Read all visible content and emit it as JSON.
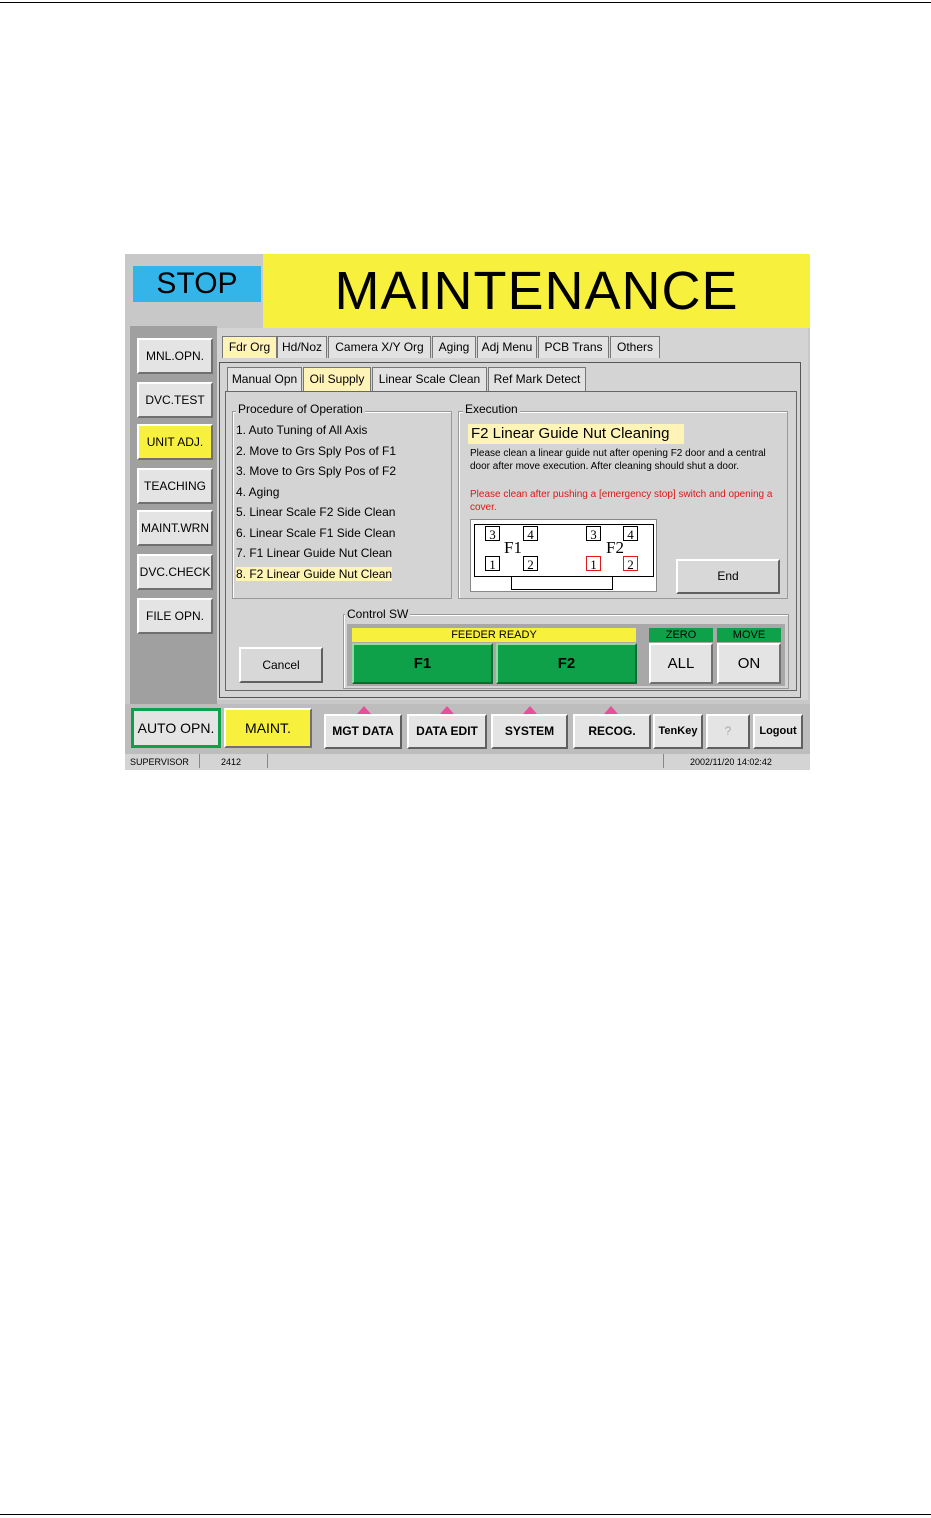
{
  "header": {
    "stop_label": "STOP",
    "title": "MAINTENANCE"
  },
  "sidebar": {
    "buttons": [
      {
        "label": "MNL.OPN."
      },
      {
        "label": "DVC.TEST"
      },
      {
        "label": "UNIT ADJ."
      },
      {
        "label": "TEACHING"
      },
      {
        "label": "MAINT.WRN"
      },
      {
        "label": "DVC.CHECK"
      },
      {
        "label": "FILE OPN."
      }
    ],
    "active_index": 2
  },
  "tabs": [
    "Fdr Org",
    "Hd/Noz",
    "Camera X/Y Org",
    "Aging",
    "Adj Menu",
    "PCB Trans",
    "Others"
  ],
  "subtabs": [
    "Manual Opn",
    "Oil Supply",
    "Linear Scale Clean",
    "Ref Mark Detect"
  ],
  "procedure": {
    "label": "Procedure of Operation",
    "steps": [
      "1. Auto Tuning of All Axis",
      "2. Move to Grs Sply Pos of F1",
      "3. Move to Grs Sply Pos of F2",
      "4. Aging",
      "5. Linear Scale F2 Side Clean",
      "6. Linear Scale F1 Side Clean",
      "7. F1 Linear Guide Nut Clean",
      "8. F2 Linear Guide Nut Clean"
    ],
    "active_step": 7
  },
  "execution": {
    "label": "Execution",
    "title": "F2 Linear Guide Nut Cleaning",
    "description": "Please clean a linear guide nut after opening F2 door and a central door after move execution. After cleaning should shut a door.",
    "warning": "Please clean after pushing a [emergency stop] switch and opening a cover.",
    "diagram": {
      "f1_label": "F1",
      "f2_label": "F2",
      "numbers": [
        "3",
        "4",
        "1",
        "2"
      ]
    },
    "end_label": "End"
  },
  "control": {
    "label": "Control SW",
    "feeder_ready": "FEEDER READY",
    "f1": "F1",
    "f2": "F2",
    "zero_label": "ZERO",
    "all_label": "ALL",
    "move_label": "MOVE",
    "on_label": "ON"
  },
  "cancel_label": "Cancel",
  "bottom": {
    "auto_opn": "AUTO OPN.",
    "maint": "MAINT.",
    "mgt_data": "MGT DATA",
    "data_edit": "DATA EDIT",
    "system": "SYSTEM",
    "recog": "RECOG.",
    "tenkey": "TenKey",
    "help": "?",
    "logout": "Logout"
  },
  "status": {
    "user": "SUPERVISOR",
    "code": "2412",
    "datetime": "2002/11/20 14:02:42"
  },
  "colors": {
    "stop": "#33b5ea",
    "title": "#f7f03c",
    "active": "#f7f03c",
    "highlight": "#fff4b8",
    "green": "#0fa14a",
    "warning": "#e01818",
    "pink": "#e84f9b"
  }
}
